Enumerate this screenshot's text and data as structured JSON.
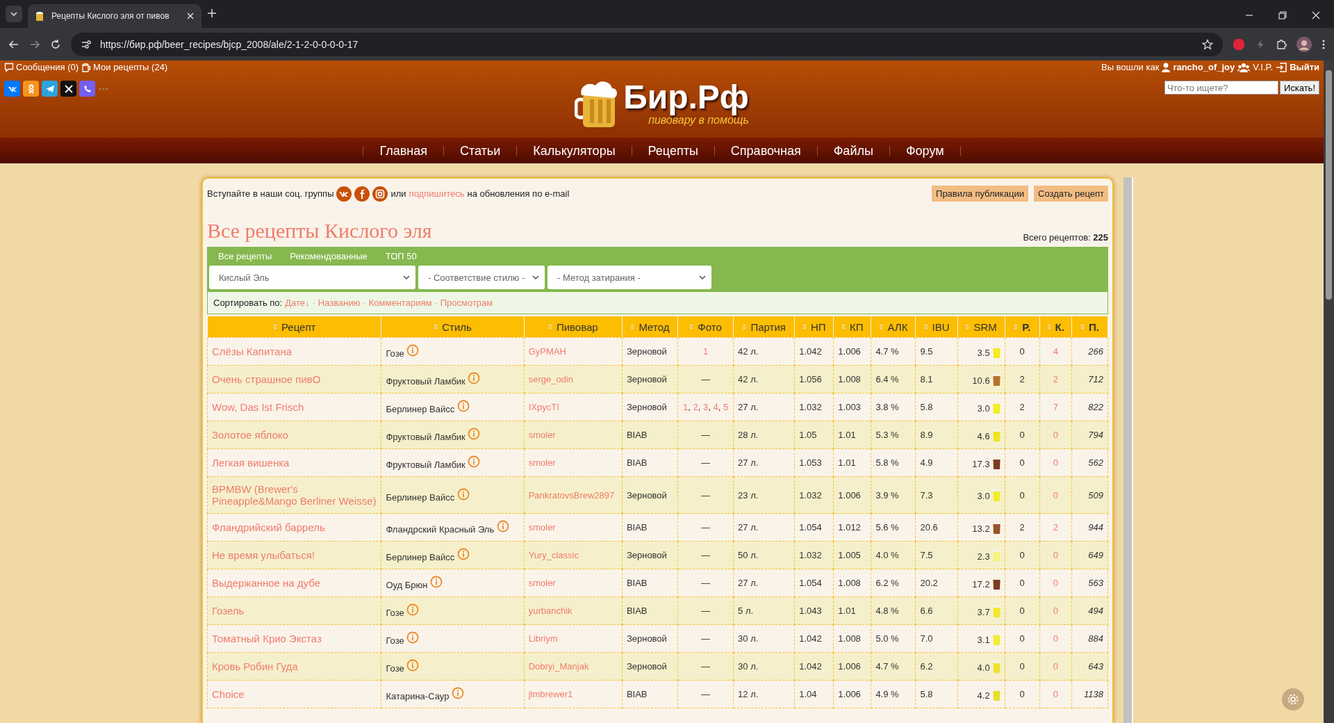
{
  "browser": {
    "tab_title": "Рецепты Кислого эля от пивов",
    "url": "https://бир.рф/beer_recipes/bjcp_2008/ale/2-1-2-0-0-0-0-17"
  },
  "header": {
    "left_links": [
      {
        "kind": "messages",
        "label": "Сообщения (0)"
      },
      {
        "kind": "recipes",
        "label": "Мои рецепты (24)"
      }
    ],
    "social": [
      {
        "kind": "vk"
      },
      {
        "kind": "ok"
      },
      {
        "kind": "telegram"
      },
      {
        "kind": "x"
      },
      {
        "kind": "viber"
      },
      {
        "kind": "more"
      }
    ],
    "logo": {
      "title": "Бир.Рф",
      "tagline": "пивовару в помощь"
    },
    "user": {
      "prefix": "Вы вошли как",
      "name": "rancho_of_joy",
      "group": "V.I.P.",
      "logout": "Выйти"
    },
    "search": {
      "placeholder": "Что-то ищете?",
      "button": "Искать!"
    }
  },
  "nav": [
    "Главная",
    "Статьи",
    "Калькуляторы",
    "Рецепты",
    "Справочная",
    "Файлы",
    "Форум"
  ],
  "panel": {
    "join": {
      "before": "Вступайте в наши соц. группы",
      "groups": [
        {
          "kind": "vk"
        },
        {
          "kind": "facebook"
        },
        {
          "kind": "instagram"
        }
      ],
      "middle": "или",
      "link": "подпишитесь",
      "after": "на обновления по e-mail"
    },
    "buttons": [
      "Правила публикации",
      "Создать рецепт"
    ],
    "title": "Все рецепты Кислого эля",
    "total": "Всего рецептов: **225**",
    "tabs": [
      "Все рецепты",
      "Рекомендованные",
      "ТОП 50"
    ],
    "filters": [
      {
        "value": "Кислый Эль"
      },
      {
        "value": "- Соответствие стилю -"
      },
      {
        "value": "- Метод затирания -"
      }
    ],
    "sort": {
      "label": "Сортировать по:",
      "separator": "·",
      "options": [
        "Дате↓",
        "Названию",
        "Комментариям",
        "Просмотрам"
      ]
    }
  },
  "table": {
    "photo_separator": ", ",
    "columns": [
      {
        "label": "Рецепт",
        "bold": false
      },
      {
        "label": "Стиль",
        "bold": false
      },
      {
        "label": "Пивовар",
        "bold": false
      },
      {
        "label": "Метод",
        "bold": false
      },
      {
        "label": "Фото",
        "bold": false
      },
      {
        "label": "Партия",
        "bold": false
      },
      {
        "label": "НП",
        "bold": false
      },
      {
        "label": "КП",
        "bold": false
      },
      {
        "label": "АЛК",
        "bold": false
      },
      {
        "label": "IBU",
        "bold": false
      },
      {
        "label": "SRM",
        "bold": false
      },
      {
        "label": "Р.",
        "bold": true
      },
      {
        "label": "К.",
        "bold": true
      },
      {
        "label": "П.",
        "bold": true
      }
    ],
    "rows": [
      {
        "name": "Слёзы Капитана",
        "style": "Гозе",
        "brewer": "GyPMAH",
        "method": "Зерновой",
        "photos": [
          "1"
        ],
        "batch": "42 л.",
        "og": "1.042",
        "fg": "1.006",
        "abv": "4.7 %",
        "ibu": "9.5",
        "srm": {
          "value": "3.5",
          "color": "#f4ea1e"
        },
        "rating": "0",
        "comments": "4",
        "views": "266"
      },
      {
        "name": "Очень страшное пивО",
        "style": "Фруктовый Ламбик",
        "brewer": "serge_odin",
        "method": "Зерновой",
        "photo": "—",
        "batch": "42 л.",
        "og": "1.056",
        "fg": "1.008",
        "abv": "6.4 %",
        "ibu": "8.1",
        "srm": {
          "value": "10.6",
          "color": "#b5722c"
        },
        "rating": "2",
        "comments": "2",
        "views": "712"
      },
      {
        "name": "Wow, Das Ist Frisch",
        "style": "Берлинер Вайсс",
        "brewer": "IXpycTI",
        "method": "Зерновой",
        "photos": [
          "1",
          "2",
          "3",
          "4",
          "5"
        ],
        "batch": "27 л.",
        "og": "1.032",
        "fg": "1.003",
        "abv": "3.8 %",
        "ibu": "5.8",
        "srm": {
          "value": "3.0",
          "color": "#f2ee24"
        },
        "rating": "2",
        "comments": "7",
        "views": "822"
      },
      {
        "name": "Золотое яблоко",
        "style": "Фруктовый Ламбик",
        "brewer": "smoler",
        "method": "BIAB",
        "photo": "—",
        "batch": "28 л.",
        "og": "1.05",
        "fg": "1.01",
        "abv": "5.3 %",
        "ibu": "8.9",
        "srm": {
          "value": "4.6",
          "color": "#eee41e"
        },
        "rating": "0",
        "comments": "0",
        "views": "794"
      },
      {
        "name": "Легкая вишенка",
        "style": "Фруктовый Ламбик",
        "brewer": "smoler",
        "method": "BIAB",
        "photo": "—",
        "batch": "27 л.",
        "og": "1.053",
        "fg": "1.01",
        "abv": "5.8 %",
        "ibu": "4.9",
        "srm": {
          "value": "17.3",
          "color": "#7b3b1e"
        },
        "rating": "0",
        "comments": "0",
        "views": "562"
      },
      {
        "name": "BPMBW (Brewer's Pineapple&Mango Berliner Weisse)",
        "style": "Берлинер Вайсс",
        "brewer": "PankratovsBrew2897",
        "method": "Зерновой",
        "photo": "—",
        "batch": "23 л.",
        "og": "1.032",
        "fg": "1.006",
        "abv": "3.9 %",
        "ibu": "7.3",
        "srm": {
          "value": "3.0",
          "color": "#f2ee24"
        },
        "rating": "0",
        "comments": "0",
        "views": "509"
      },
      {
        "name": "Фландрийский баррель",
        "style": "Фландрский Красный Эль",
        "brewer": "smoler",
        "method": "BIAB",
        "photo": "—",
        "batch": "27 л.",
        "og": "1.054",
        "fg": "1.012",
        "abv": "5.6 %",
        "ibu": "20.6",
        "srm": {
          "value": "13.2",
          "color": "#9c5226"
        },
        "rating": "2",
        "comments": "2",
        "views": "944"
      },
      {
        "name": "Не время улыбаться!",
        "style": "Берлинер Вайсс",
        "brewer": "Yury_classic",
        "method": "Зерновой",
        "photo": "—",
        "batch": "50 л.",
        "og": "1.032",
        "fg": "1.005",
        "abv": "4.0 %",
        "ibu": "7.5",
        "srm": {
          "value": "2.3",
          "color": "#f6f27a"
        },
        "rating": "0",
        "comments": "0",
        "views": "649"
      },
      {
        "name": "Выдержанное на дубе",
        "style": "Оуд Брюн",
        "brewer": "smoler",
        "method": "BIAB",
        "photo": "—",
        "batch": "27 л.",
        "og": "1.054",
        "fg": "1.008",
        "abv": "6.2 %",
        "ibu": "20.2",
        "srm": {
          "value": "17.2",
          "color": "#7b3b1e"
        },
        "rating": "0",
        "comments": "0",
        "views": "563"
      },
      {
        "name": "Гозель",
        "style": "Гозе",
        "brewer": "yurbanchik",
        "method": "BIAB",
        "photo": "—",
        "batch": "5 л.",
        "og": "1.043",
        "fg": "1.01",
        "abv": "4.8 %",
        "ibu": "6.6",
        "srm": {
          "value": "3.7",
          "color": "#f0e82c"
        },
        "rating": "0",
        "comments": "0",
        "views": "494"
      },
      {
        "name": "Томатный Крио Экстаз",
        "style": "Гозе",
        "brewer": "Libriym",
        "method": "Зерновой",
        "photo": "—",
        "batch": "30 л.",
        "og": "1.042",
        "fg": "1.008",
        "abv": "5.0 %",
        "ibu": "7.0",
        "srm": {
          "value": "3.1",
          "color": "#f2ec2c"
        },
        "rating": "0",
        "comments": "0",
        "views": "884"
      },
      {
        "name": "Кровь Робин Гуда",
        "style": "Гозе",
        "brewer": "Dobryi_Manjak",
        "method": "Зерновой",
        "photo": "—",
        "batch": "30 л.",
        "og": "1.042",
        "fg": "1.006",
        "abv": "4.7 %",
        "ibu": "6.2",
        "srm": {
          "value": "4.0",
          "color": "#ece22a"
        },
        "rating": "0",
        "comments": "0",
        "views": "643"
      },
      {
        "name": "Choice",
        "style": "Катарина-Саур",
        "brewer": "jlmbrewer1",
        "method": "BIAB",
        "photo": "—",
        "batch": "12 л.",
        "og": "1.04",
        "fg": "1.006",
        "abv": "4.9 %",
        "ibu": "5.8",
        "srm": {
          "value": "4.2",
          "color": "#e8df28"
        },
        "rating": "0",
        "comments": "0",
        "views": "1138"
      }
    ]
  }
}
